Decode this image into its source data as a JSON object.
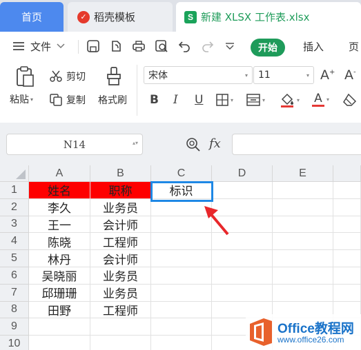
{
  "tabs": {
    "home": "首页",
    "docer": "稻壳模板",
    "file": "新建 XLSX 工作表.xlsx"
  },
  "menu": {
    "file": "文件",
    "start": "开始",
    "insert": "插入",
    "page": "页"
  },
  "ribbon": {
    "paste": "粘贴",
    "cut": "剪切",
    "copy": "复制",
    "format_painter": "格式刷",
    "font_name": "宋体",
    "font_size": "11",
    "bold": "B",
    "italic": "I",
    "underline": "U",
    "font_color_letter": "A"
  },
  "formula_bar": {
    "name_box": "N14",
    "fx": "fx",
    "formula": ""
  },
  "sheet": {
    "columns": [
      "A",
      "B",
      "C",
      "D",
      "E"
    ],
    "rows": [
      "1",
      "2",
      "3",
      "4",
      "5",
      "6",
      "7",
      "8",
      "9",
      "10"
    ],
    "cells": {
      "A1": "姓名",
      "B1": "职称",
      "C1": "标识",
      "A2": "李久",
      "B2": "业务员",
      "A3": "王一",
      "B3": "会计师",
      "A4": "陈晓",
      "B4": "工程师",
      "A5": "林丹",
      "B5": "会计师",
      "A6": "吴晓丽",
      "B6": "业务员",
      "A7": "邱珊珊",
      "B7": "业务员",
      "A8": "田野",
      "B8": "工程师"
    },
    "header_fill_color": "#fe0000",
    "selection_color": "#1e88e5",
    "arrow_color": "#e8272b"
  },
  "watermark": {
    "brand": "Office教程网",
    "url": "www.office26.com"
  },
  "colors": {
    "accent_green": "#1e9b5a",
    "tab_blue": "#4d89ee"
  }
}
